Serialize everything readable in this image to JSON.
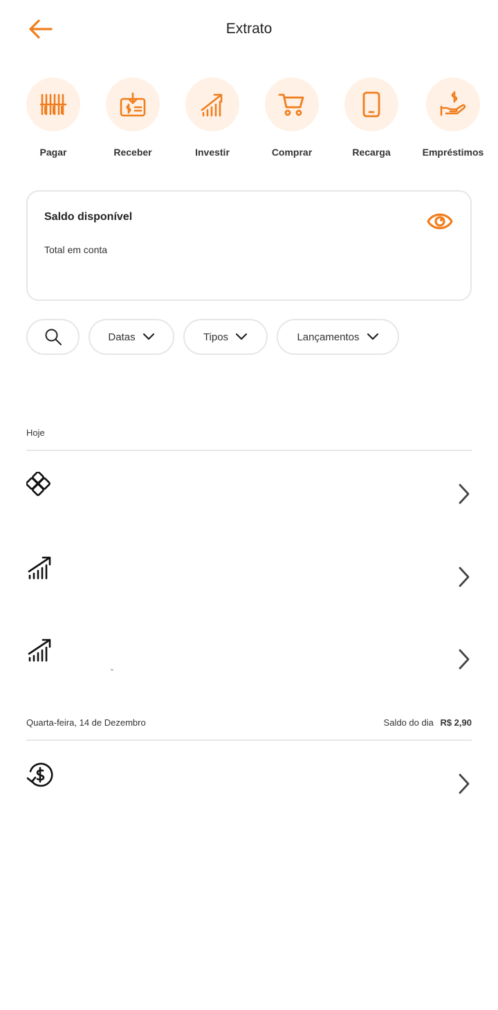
{
  "header": {
    "title": "Extrato",
    "back_icon": "arrow-left-icon"
  },
  "colors": {
    "accent": "#f07e1e",
    "accent_soft": "#fff1e5",
    "border": "#e6e6e6",
    "text": "#222222"
  },
  "quick_actions": [
    {
      "label": "Pagar",
      "icon": "barcode-icon"
    },
    {
      "label": "Receber",
      "icon": "receive-money-icon"
    },
    {
      "label": "Investir",
      "icon": "investment-chart-icon"
    },
    {
      "label": "Comprar",
      "icon": "shopping-cart-icon"
    },
    {
      "label": "Recarga",
      "icon": "phone-recharge-icon"
    },
    {
      "label": "Empréstimos",
      "icon": "loan-hand-icon"
    }
  ],
  "balance": {
    "title": "Saldo disponível",
    "subtitle": "Total em conta",
    "toggle_icon": "eye-icon"
  },
  "filters": {
    "search_icon": "search-icon",
    "chips": [
      {
        "label": "Datas",
        "icon": "chevron-down-icon"
      },
      {
        "label": "Tipos",
        "icon": "chevron-down-icon"
      },
      {
        "label": "Lançamentos",
        "icon": "chevron-down-icon"
      }
    ]
  },
  "sections": [
    {
      "label": "Hoje",
      "transactions": [
        {
          "icon": "pix-icon"
        },
        {
          "icon": "investment-chart-icon"
        },
        {
          "icon": "investment-chart-icon",
          "fragment": "˜"
        }
      ]
    },
    {
      "label": "Quarta-feira, 14 de Dezembro",
      "balance_label": "Saldo do dia",
      "balance_value": "R$ 2,90",
      "transactions": [
        {
          "icon": "refund-dollar-icon"
        }
      ]
    }
  ]
}
